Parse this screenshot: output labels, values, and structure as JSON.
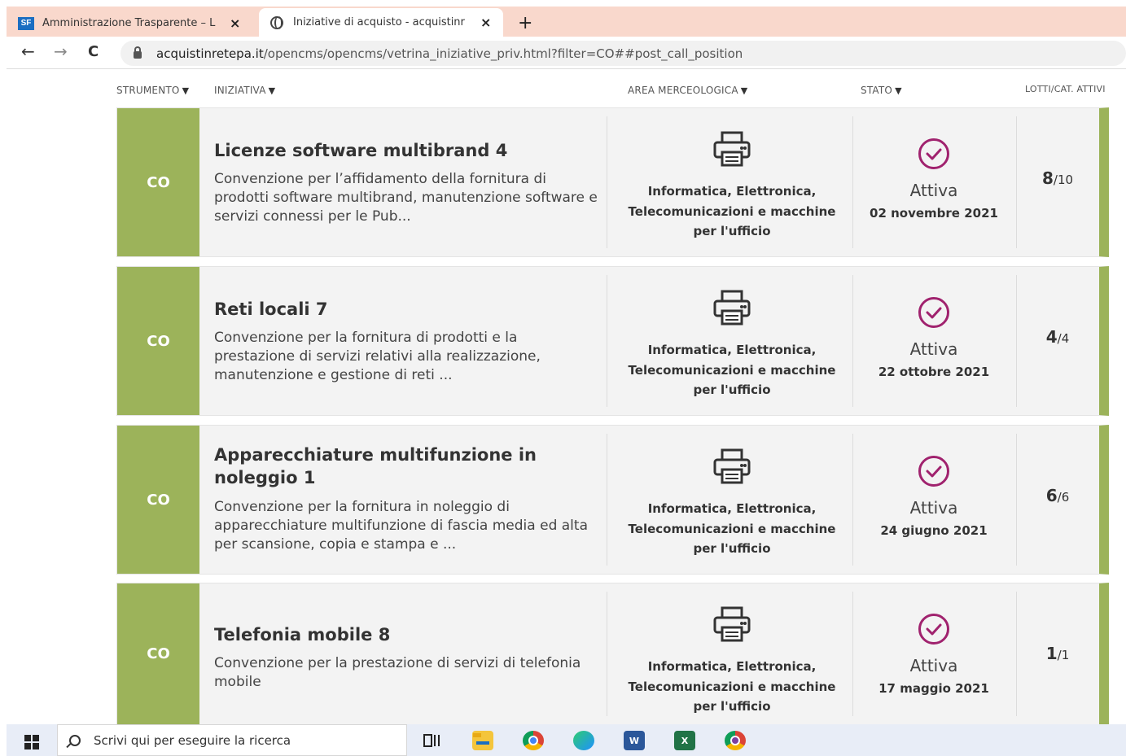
{
  "browser": {
    "tabs": [
      {
        "icon": "sf-logo",
        "logo_text": "SF",
        "title": "Amministrazione Trasparente – L",
        "close": "×"
      },
      {
        "icon": "globe-icon",
        "title": "Iniziative di acquisto - acquistinr",
        "close": "×"
      }
    ],
    "new_tab": "+",
    "nav": {
      "back": "←",
      "forward": "→",
      "reload": "C"
    },
    "url_host": "acquistinretepa.it",
    "url_path": "/opencms/opencms/vetrina_iniziative_priv.html?filter=CO##post_call_position"
  },
  "columns": {
    "strumento": "STRUMENTO",
    "iniziativa": "INIZIATIVA",
    "area": "AREA MERCEOLOGICA",
    "stato": "STATO",
    "lotti": "LOTTI/CAT. ATTIVI",
    "arrow": "▼"
  },
  "cards": [
    {
      "strumento": "CO",
      "title": "Licenze software multibrand 4",
      "description": "Convenzione per l’affidamento della fornitura di prodotti software multibrand, manutenzione software e servizi connessi per le Pub...",
      "area_line1": "Informatica, Elettronica,",
      "area_line2": "Telecomunicazioni e macchine",
      "area_line3": "per l'ufficio",
      "stato": "Attiva",
      "date": "02 novembre 2021",
      "lotti_active": "8",
      "lotti_total": "/10"
    },
    {
      "strumento": "CO",
      "title": "Reti locali 7",
      "description": "Convenzione per la fornitura di prodotti e la prestazione di servizi relativi alla realizzazione, manutenzione e gestione di reti ...",
      "area_line1": "Informatica, Elettronica,",
      "area_line2": "Telecomunicazioni e macchine",
      "area_line3": "per l'ufficio",
      "stato": "Attiva",
      "date": "22 ottobre 2021",
      "lotti_active": "4",
      "lotti_total": "/4"
    },
    {
      "strumento": "CO",
      "title": "Apparecchiature multifunzione in noleggio 1",
      "description": "Convenzione per la fornitura in noleggio di apparecchiature multifunzione di fascia media ed alta per scansione, copia e stampa e ...",
      "area_line1": "Informatica, Elettronica,",
      "area_line2": "Telecomunicazioni e macchine",
      "area_line3": "per l'ufficio",
      "stato": "Attiva",
      "date": "24 giugno 2021",
      "lotti_active": "6",
      "lotti_total": "/6"
    },
    {
      "strumento": "CO",
      "title": "Telefonia mobile 8",
      "description": "Convenzione per la prestazione di servizi di telefonia mobile",
      "area_line1": "Informatica, Elettronica,",
      "area_line2": "Telecomunicazioni e macchine",
      "area_line3": "per l'ufficio",
      "stato": "Attiva",
      "date": "17 maggio 2021",
      "lotti_active": "1",
      "lotti_total": "/1"
    }
  ],
  "colors": {
    "accent_green": "#9cb35a",
    "status_purple": "#a0226e",
    "tabstrip": "#f9d8cc"
  },
  "taskbar": {
    "search_placeholder": "Scrivi qui per eseguire la ricerca",
    "icons": [
      "windows-logo-icon",
      "task-view-icon",
      "file-explorer-icon",
      "chrome-icon",
      "edge-icon",
      "word-icon",
      "excel-icon",
      "chrome-canary-icon"
    ]
  }
}
